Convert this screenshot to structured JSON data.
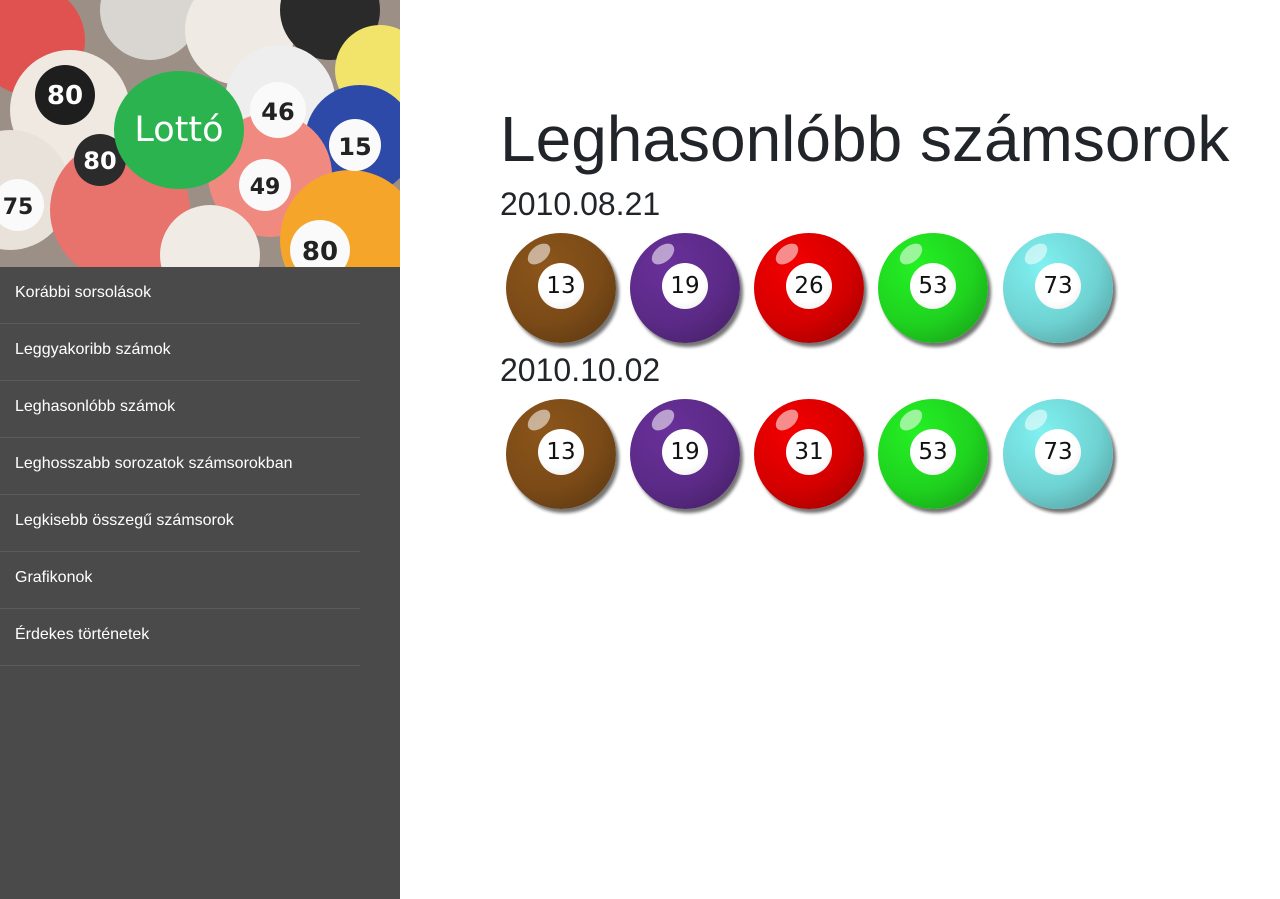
{
  "sidebar": {
    "logo_text": "Lottó",
    "header_image": "lottery-balls-photo",
    "items": [
      {
        "label": "Korábbi sorsolások"
      },
      {
        "label": "Leggyakoribb számok"
      },
      {
        "label": "Leghasonlóbb számok"
      },
      {
        "label": "Leghosszabb sorozatok számsorokban"
      },
      {
        "label": "Legkisebb összegű számsorok"
      },
      {
        "label": "Grafikonok"
      },
      {
        "label": "Érdekes történetek"
      }
    ]
  },
  "main": {
    "title": "Leghasonlóbb számsorok",
    "draws": [
      {
        "date": "2010.08.21",
        "numbers": [
          "13",
          "19",
          "26",
          "53",
          "73"
        ]
      },
      {
        "date": "2010.10.02",
        "numbers": [
          "13",
          "19",
          "31",
          "53",
          "73"
        ]
      }
    ]
  },
  "colors": {
    "sidebar_bg": "#4a4a4a",
    "logo_bg": "#2bb34f",
    "ball_colors": [
      "#7a4a17",
      "#5b2a86",
      "#d40000",
      "#1fd21f",
      "#6fd2d2"
    ]
  }
}
